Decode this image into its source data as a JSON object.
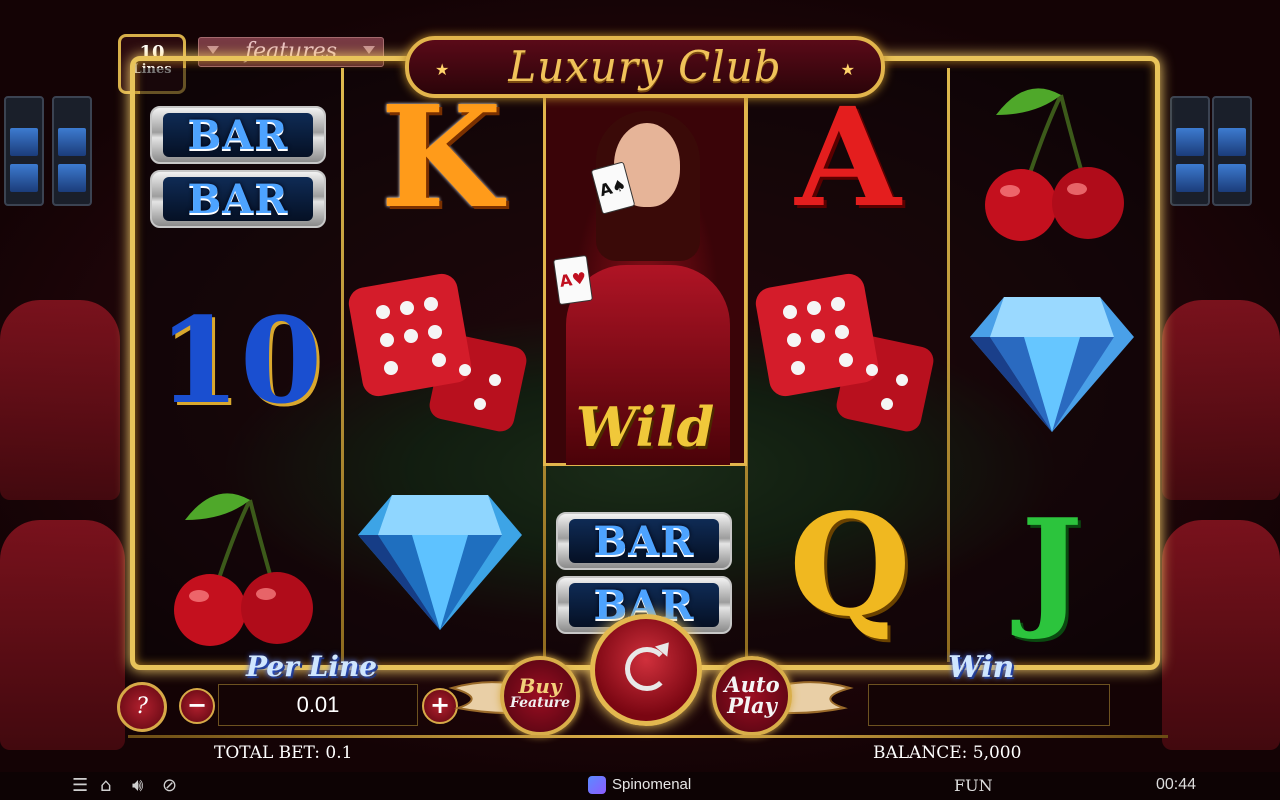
{
  "game": {
    "title": "Luxury Club",
    "lines_count": "10",
    "lines_label": "Lines",
    "features_label": "features"
  },
  "reels": [
    [
      "BAR BAR",
      "10",
      "cherry"
    ],
    [
      "K",
      "dice",
      "diamond"
    ],
    [
      "Wild",
      "BAR BAR"
    ],
    [
      "A",
      "dice",
      "Q"
    ],
    [
      "cherry",
      "diamond",
      "J"
    ]
  ],
  "symbols": {
    "bar": "BAR",
    "ten": "10",
    "k": "K",
    "a": "A",
    "q": "Q",
    "j": "J",
    "wild": "Wild"
  },
  "controls": {
    "help": "?",
    "per_line_label": "Per Line",
    "per_line_value": "0.01",
    "minus": "−",
    "plus": "+",
    "buy_label": "Buy",
    "buy_sub": "Feature",
    "auto_label": "Auto",
    "auto_sub": "Play",
    "win_label": "Win",
    "win_value": ""
  },
  "footer": {
    "total_bet": "TOTAL BET: 0.1",
    "balance": "BALANCE: 5,000",
    "brand": "Spinomenal",
    "mode": "FUN",
    "clock": "00:44"
  },
  "colors": {
    "gold": "#e2b54c",
    "accent_red": "#9b0e22",
    "label_blue": "#cfe6ff"
  }
}
